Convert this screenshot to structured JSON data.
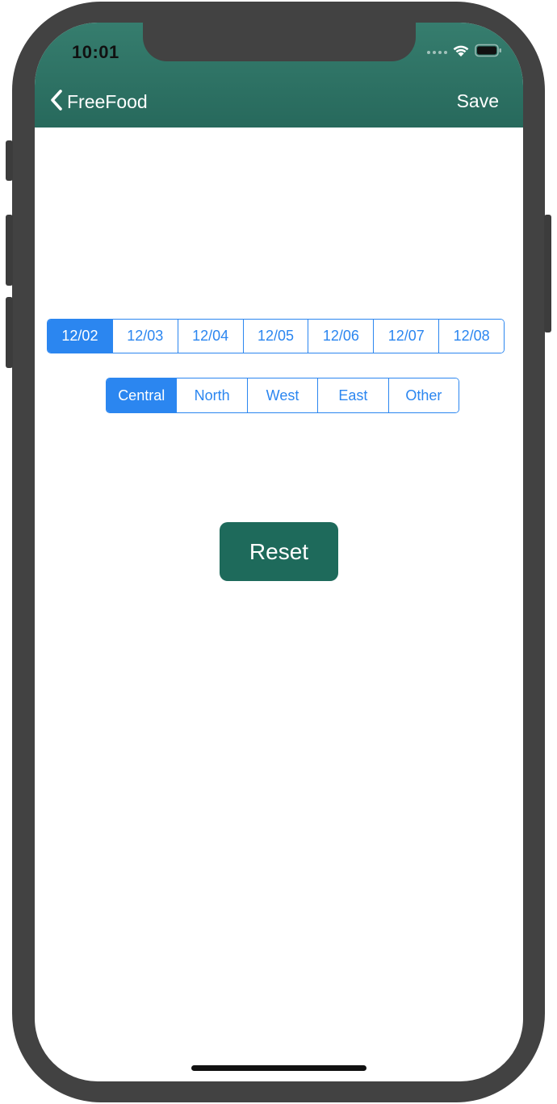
{
  "status_bar": {
    "time": "10:01"
  },
  "nav_bar": {
    "back_label": "FreeFood",
    "save_label": "Save"
  },
  "date_selector": {
    "options": [
      "12/02",
      "12/03",
      "12/04",
      "12/05",
      "12/06",
      "12/07",
      "12/08"
    ],
    "selected": "12/02"
  },
  "region_selector": {
    "options": [
      "Central",
      "North",
      "West",
      "East",
      "Other"
    ],
    "selected": "Central"
  },
  "actions": {
    "reset_label": "Reset"
  },
  "colors": {
    "header": "#2f7566",
    "accent_blue": "#2b86f0",
    "reset_button": "#1e6a5b",
    "device_frame": "#424242"
  },
  "icons": {
    "back": "chevron-left-icon",
    "wifi": "wifi-icon",
    "battery": "battery-icon",
    "signal": "cellular-signal-icon"
  }
}
